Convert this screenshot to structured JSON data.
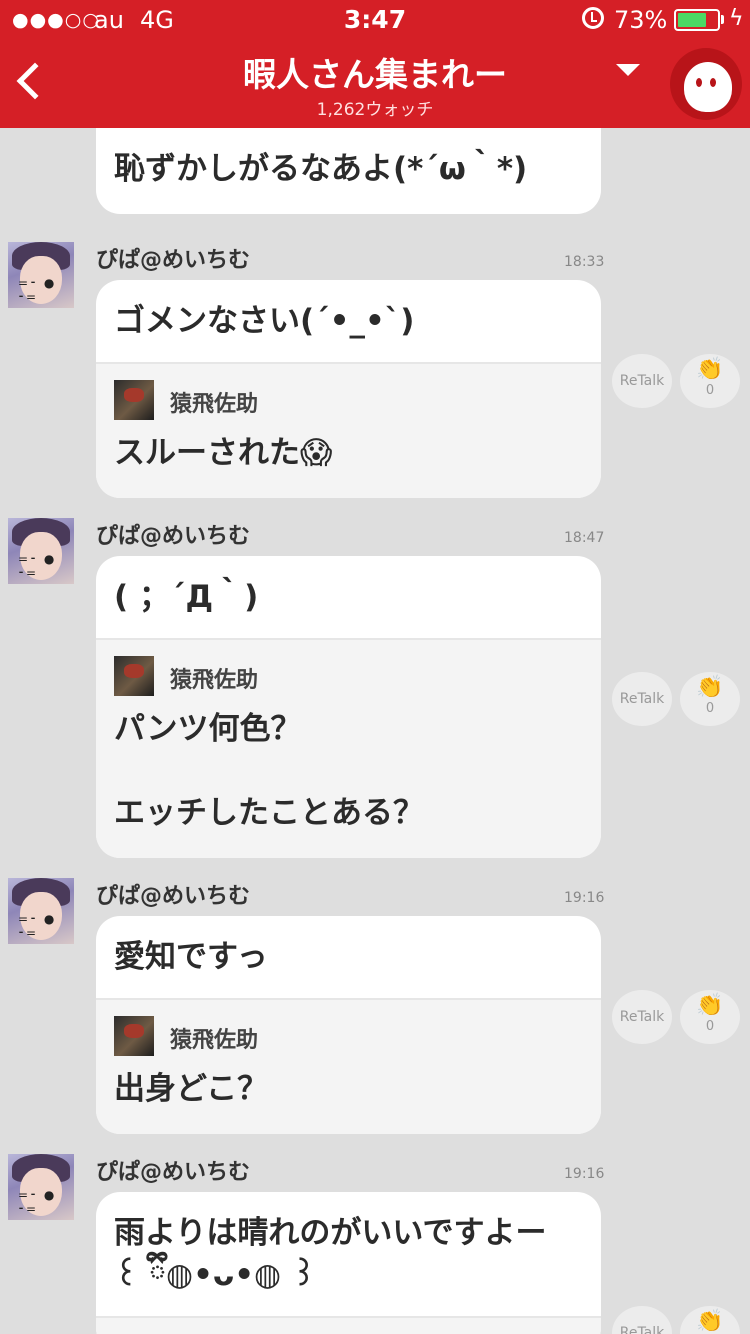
{
  "status": {
    "signal": "●●●○○",
    "carrier": "au",
    "network": "4G",
    "time": "3:47",
    "battery_pct": "73%",
    "battery_level": 0.73,
    "charging_glyph": "ϟ"
  },
  "header": {
    "title": "暇人さん集まれー",
    "subtitle": "1,262ウォッチ",
    "color": "#d51f26"
  },
  "top_partial": {
    "text": "恥ずかしがるなあよ(*´ω｀*)"
  },
  "retalk_label": "ReTalk",
  "messages": [
    {
      "name": "ぴぱ@めいちむ",
      "time": "18:33",
      "text": "ゴメンなさい(´•_•`)",
      "reply": {
        "name": "猿飛佐助",
        "text": "スルーされた😱"
      },
      "claps": "0"
    },
    {
      "name": "ぴぱ@めいちむ",
      "time": "18:47",
      "text": "( ；´Д｀)",
      "reply": {
        "name": "猿飛佐助",
        "text": "パンツ何色？\n\nエッチしたことある？"
      },
      "claps": "0"
    },
    {
      "name": "ぴぱ@めいちむ",
      "time": "19:16",
      "text": "愛知ですっ",
      "reply": {
        "name": "猿飛佐助",
        "text": "出身どこ？"
      },
      "claps": "0"
    },
    {
      "name": "ぴぱ@めいちむ",
      "time": "19:16",
      "text": "雨よりは晴れのがいいですよー\n꒰ ྀི◍•ᴗ•◍ ꒱",
      "reply": {
        "name": "",
        "text": ""
      },
      "claps": ""
    }
  ]
}
